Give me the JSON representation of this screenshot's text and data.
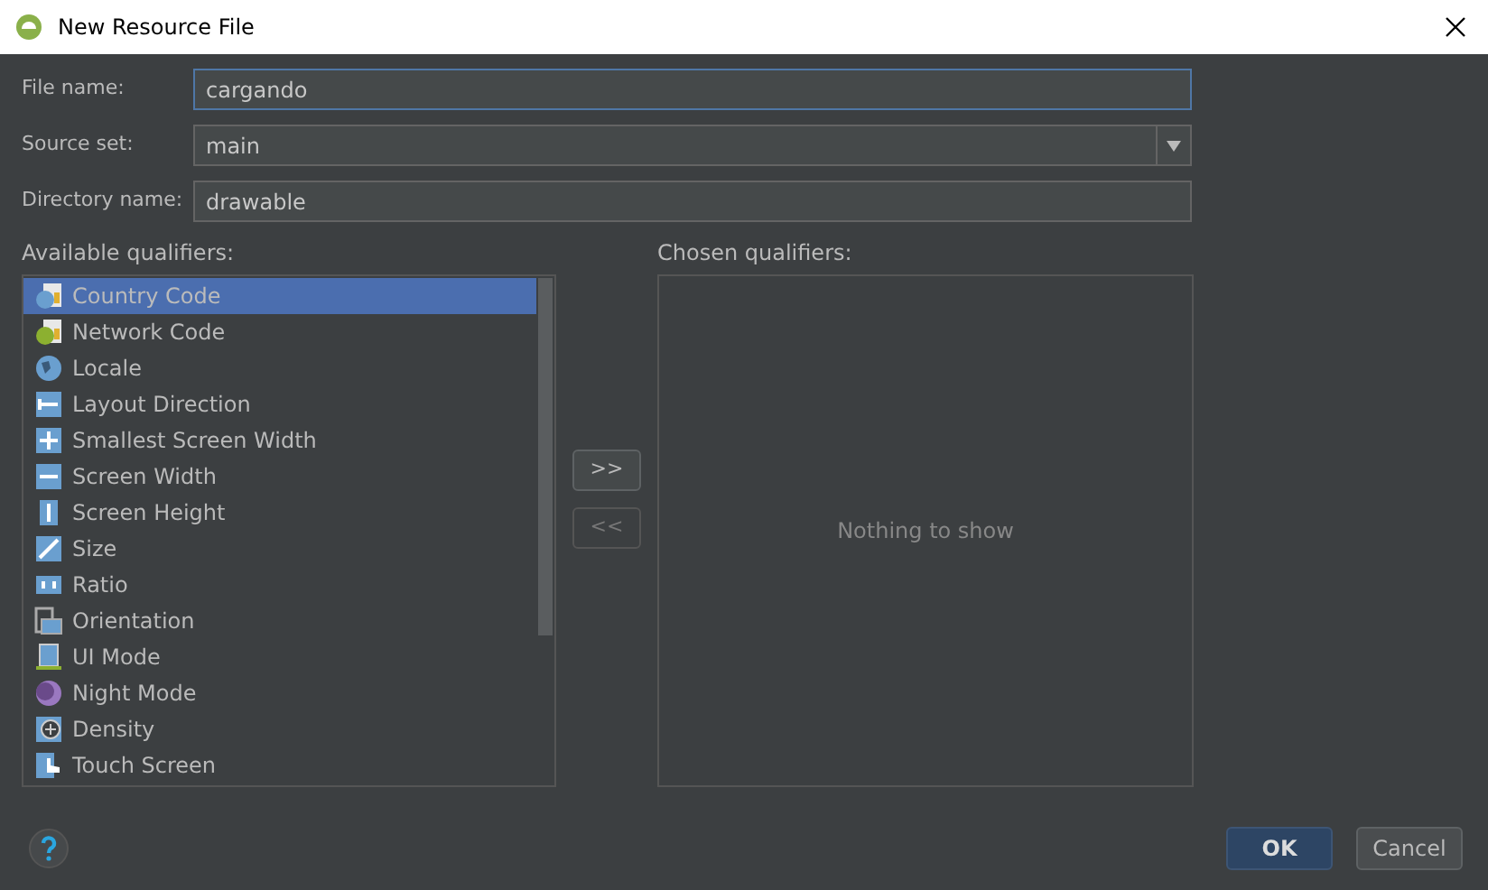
{
  "window": {
    "title": "New Resource File"
  },
  "fields": [
    {
      "label": "File name:",
      "value": "cargando",
      "focused": true,
      "kind": "text"
    },
    {
      "label": "Source set:",
      "value": "main",
      "focused": false,
      "kind": "dropdown"
    },
    {
      "label": "Directory name:",
      "value": "drawable",
      "focused": false,
      "kind": "text"
    }
  ],
  "available": {
    "label": "Available qualifiers:",
    "items": [
      {
        "label": "Country Code",
        "selected": true
      },
      {
        "label": "Network Code",
        "selected": false
      },
      {
        "label": "Locale",
        "selected": false
      },
      {
        "label": "Layout Direction",
        "selected": false
      },
      {
        "label": "Smallest Screen Width",
        "selected": false
      },
      {
        "label": "Screen Width",
        "selected": false
      },
      {
        "label": "Screen Height",
        "selected": false
      },
      {
        "label": "Size",
        "selected": false
      },
      {
        "label": "Ratio",
        "selected": false
      },
      {
        "label": "Orientation",
        "selected": false
      },
      {
        "label": "UI Mode",
        "selected": false
      },
      {
        "label": "Night Mode",
        "selected": false
      },
      {
        "label": "Density",
        "selected": false
      },
      {
        "label": "Touch Screen",
        "selected": false
      }
    ]
  },
  "move_buttons": [
    {
      "label": ">>",
      "disabled": false
    },
    {
      "label": "<<",
      "disabled": true
    }
  ],
  "chosen": {
    "label": "Chosen qualifiers:",
    "empty_text": "Nothing to show"
  },
  "buttons": [
    {
      "label": "OK",
      "kind": "default"
    },
    {
      "label": "Cancel",
      "kind": "normal"
    }
  ]
}
